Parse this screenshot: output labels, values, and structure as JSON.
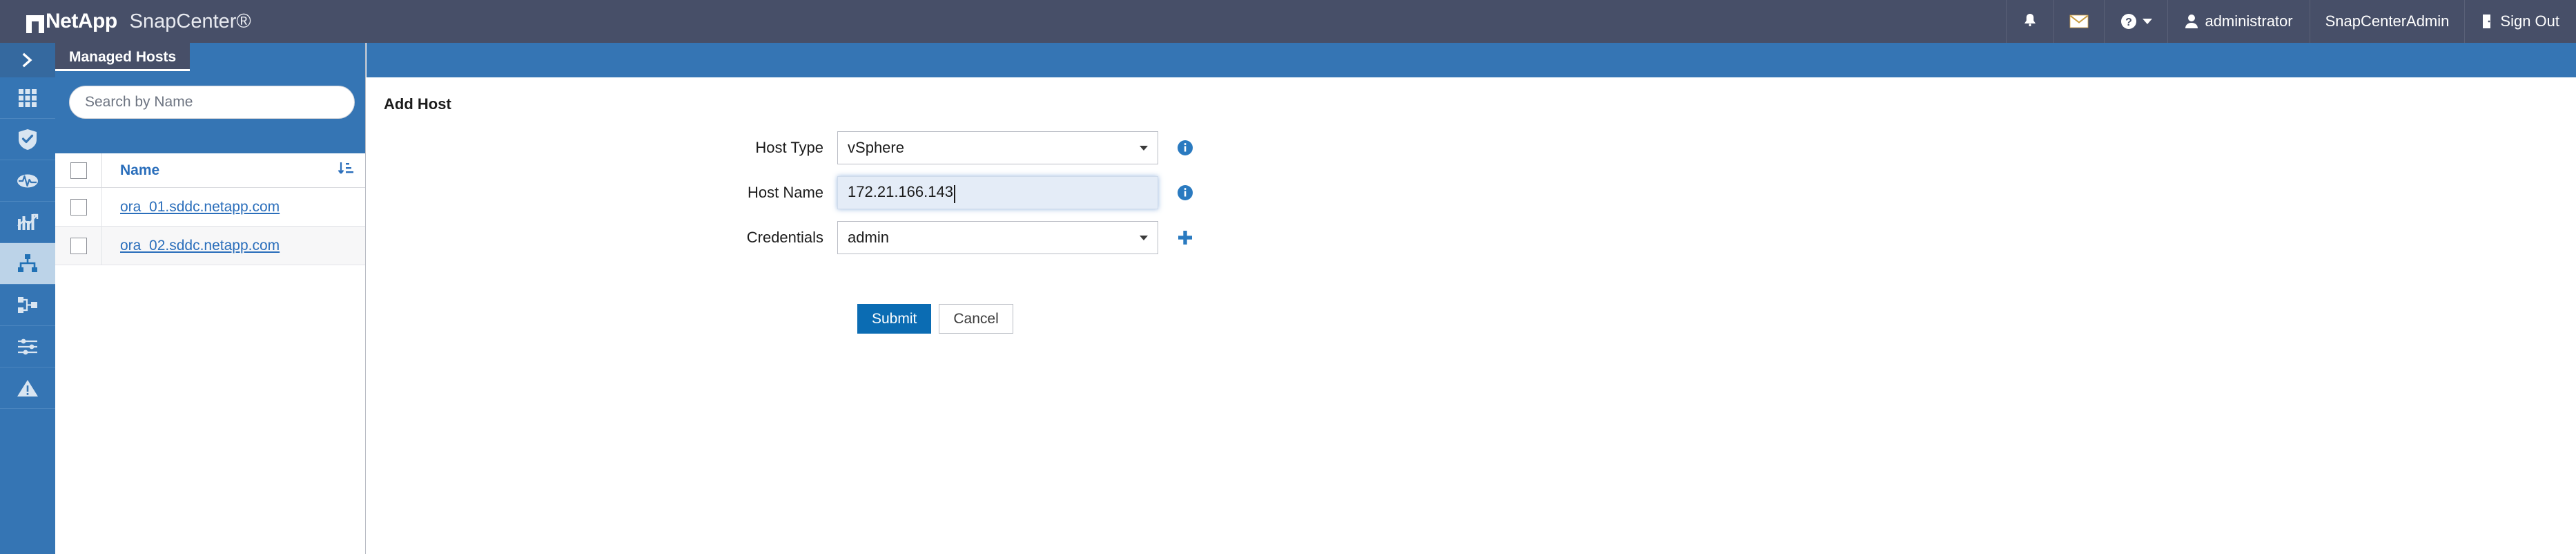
{
  "header": {
    "brand": "NetApp",
    "product": "SnapCenter®",
    "icons": {
      "bell": "bell-icon",
      "mail": "mail-icon",
      "help": "help-circle-icon"
    },
    "user": "administrator",
    "role": "SnapCenterAdmin",
    "signout": "Sign Out"
  },
  "rail": {
    "items": [
      {
        "name": "expand-panel",
        "icon": "chevron-right-icon",
        "active": false
      },
      {
        "name": "dashboard",
        "icon": "grid-icon",
        "active": false
      },
      {
        "name": "resources",
        "icon": "shield-check-icon",
        "active": false
      },
      {
        "name": "monitor",
        "icon": "pulse-icon",
        "active": false
      },
      {
        "name": "reports",
        "icon": "bar-chart-icon",
        "active": false
      },
      {
        "name": "hosts",
        "icon": "hierarchy-icon",
        "active": true
      },
      {
        "name": "storage-systems",
        "icon": "nodes-icon",
        "active": false
      },
      {
        "name": "settings",
        "icon": "sliders-icon",
        "active": false
      },
      {
        "name": "alerts",
        "icon": "warning-triangle-icon",
        "active": false
      }
    ]
  },
  "left_panel": {
    "tab_label": "Managed Hosts",
    "search": {
      "placeholder": "Search by Name",
      "value": ""
    },
    "table": {
      "column_header": "Name",
      "sort_icon": "sort-descending-icon",
      "rows": [
        {
          "name": "ora_01.sddc.netapp.com"
        },
        {
          "name": "ora_02.sddc.netapp.com"
        }
      ]
    }
  },
  "main": {
    "title": "Add Host",
    "fields": [
      {
        "label": "Host Type",
        "value": "vSphere",
        "type": "select",
        "trailing_icon": "info-icon",
        "focused": false
      },
      {
        "label": "Host Name",
        "value": "172.21.166.143",
        "type": "text",
        "trailing_icon": "info-icon",
        "focused": true
      },
      {
        "label": "Credentials",
        "value": "admin",
        "type": "select",
        "trailing_icon": "plus-icon",
        "focused": false
      }
    ],
    "buttons": {
      "submit": "Submit",
      "cancel": "Cancel"
    }
  },
  "colors": {
    "header_bg": "#474f68",
    "accent_blue": "#3575b4",
    "link_blue": "#2a6ebb",
    "primary_btn": "#0b6cb3",
    "info_icon": "#2a7ac0",
    "rail_active": "#bcd3e8"
  }
}
